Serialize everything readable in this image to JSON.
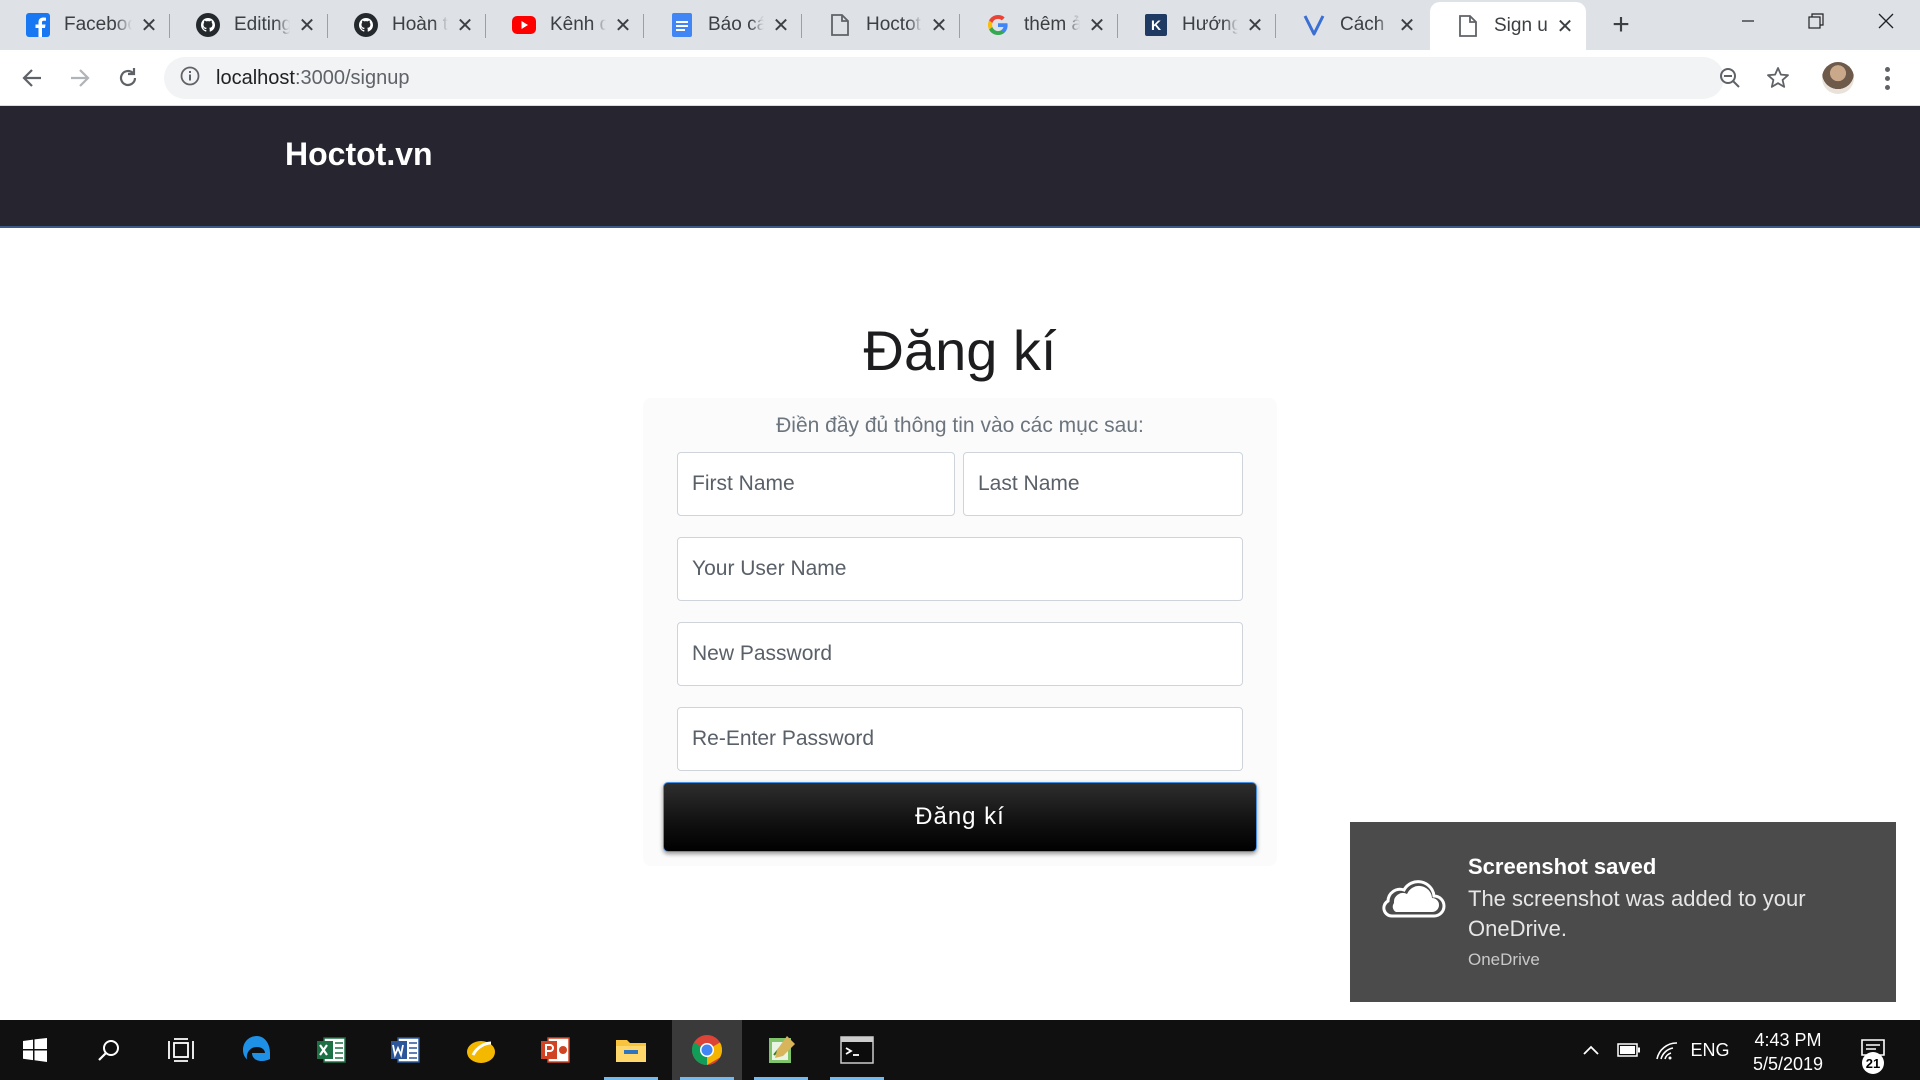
{
  "browser": {
    "tabs": [
      {
        "title": "Facebook",
        "icon": "facebook-icon"
      },
      {
        "title": "Editing",
        "icon": "github-icon"
      },
      {
        "title": "Hoàn tất",
        "icon": "github-icon"
      },
      {
        "title": "Kênh dạy",
        "icon": "youtube-icon"
      },
      {
        "title": "Báo cáo",
        "icon": "google-docs-icon"
      },
      {
        "title": "Hoctot.vn",
        "icon": "page-icon"
      },
      {
        "title": "thêm ảnh",
        "icon": "google-icon"
      },
      {
        "title": "Hướng dẫn",
        "icon": "k-icon"
      },
      {
        "title": "Cách sử",
        "icon": "v-icon"
      },
      {
        "title": "Sign up",
        "icon": "page-icon",
        "active": true
      }
    ],
    "url_host": "localhost",
    "url_path": ":3000/signup"
  },
  "site": {
    "brand": "Hoctot.vn"
  },
  "signup": {
    "heading": "Đăng kí",
    "subtitle": "Điền đầy đủ thông tin vào các mục sau:",
    "first_name_placeholder": "First Name",
    "last_name_placeholder": "Last Name",
    "username_placeholder": "Your User Name",
    "password_placeholder": "New Password",
    "reenter_placeholder": "Re-Enter Password",
    "submit_label": "Đăng kí"
  },
  "toast": {
    "title": "Screenshot saved",
    "body": "The screenshot was added to your OneDrive.",
    "source": "OneDrive"
  },
  "taskbar": {
    "apps": [
      "windows-start-icon",
      "search-icon",
      "task-view-icon",
      "edge-icon",
      "excel-icon",
      "word-icon",
      "app-icon",
      "powerpoint-icon",
      "file-explorer-icon",
      "chrome-icon",
      "notepad-icon",
      "terminal-icon"
    ],
    "language": "ENG",
    "time": "4:43 PM",
    "date": "5/5/2019",
    "notification_count": "21"
  },
  "colors": {
    "navbar": "#27252f",
    "button": "#000000",
    "toast": "#4b4b4b",
    "taskbar": "#101010"
  }
}
